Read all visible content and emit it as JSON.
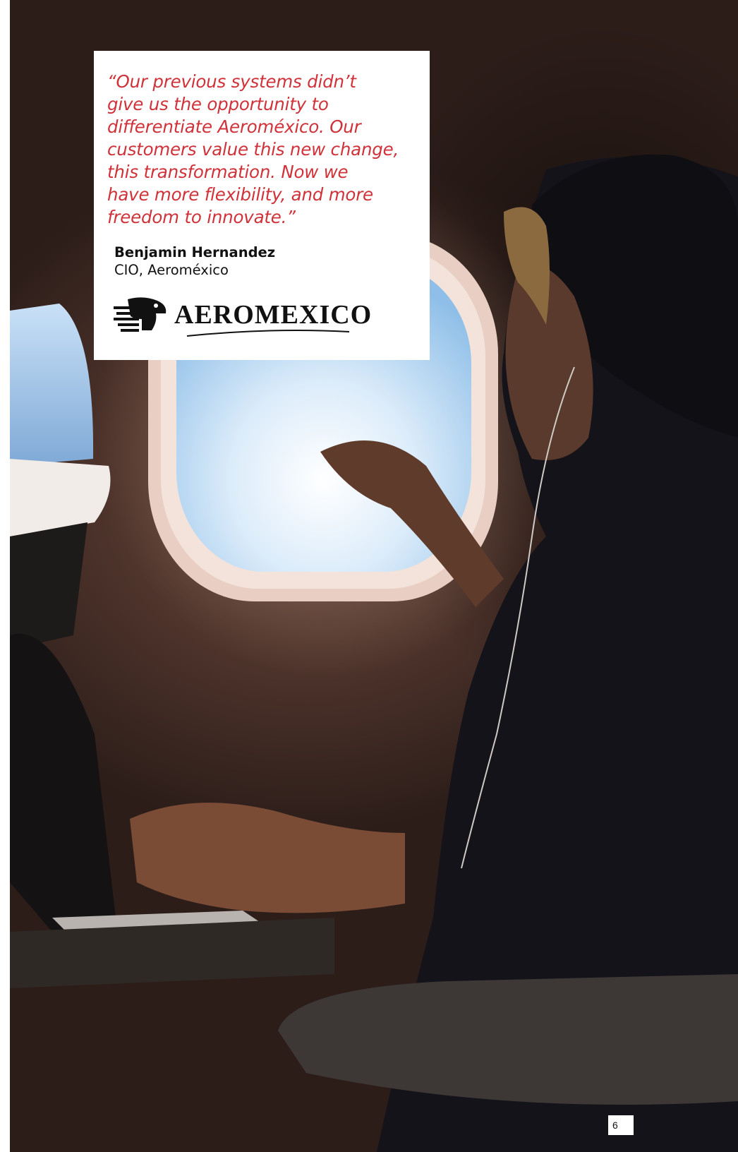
{
  "quote": {
    "text": "“Our previous systems didn’t\n give us the opportunity to\n differentiate Aeroméxico. Our\n customers value this new change,\n this transformation. Now we\n have more flexibility, and more\n freedom to innovate.”",
    "author_name": "Benjamin Hernandez",
    "author_role": "CIO, Aeroméxico"
  },
  "logo": {
    "wordmark": "AEROMEXICO",
    "icon": "eagle-head-icon"
  },
  "page_number": "6",
  "colors": {
    "quote_text": "#d0323a",
    "card_background": "#ffffff",
    "cabin_shadow": "#2a1c18"
  },
  "photo": {
    "icon": "airplane-cabin-photo"
  }
}
